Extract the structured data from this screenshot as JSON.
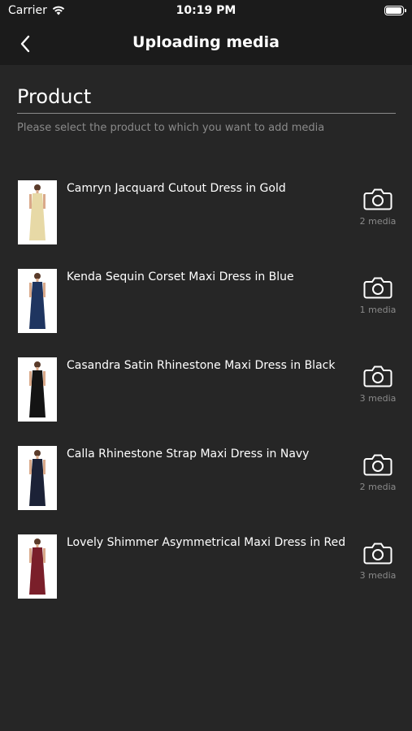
{
  "status_bar": {
    "carrier": "Carrier",
    "time": "10:19 PM",
    "battery_level": 1.0
  },
  "nav": {
    "title": "Uploading media",
    "back_icon": "chevron-left-icon"
  },
  "section": {
    "title": "Product",
    "hint": "Please select the product to which you want to add media"
  },
  "products": [
    {
      "name": "Camryn Jacquard Cutout Dress in Gold",
      "media": "2 media",
      "dress_color": "#e7d9a6",
      "icon": "camera-icon"
    },
    {
      "name": "Kenda Sequin Corset Maxi Dress in Blue",
      "media": "1 media",
      "dress_color": "#1f3560",
      "icon": "camera-icon"
    },
    {
      "name": "Casandra Satin Rhinestone Maxi Dress in Black",
      "media": "3 media",
      "dress_color": "#141414",
      "icon": "camera-icon"
    },
    {
      "name": "Calla Rhinestone Strap Maxi Dress in Navy",
      "media": "2 media",
      "dress_color": "#1c2237",
      "icon": "camera-icon"
    },
    {
      "name": "Lovely Shimmer Asymmetrical Maxi Dress in Red",
      "media": "3 media",
      "dress_color": "#7a1f2a",
      "icon": "camera-icon"
    }
  ],
  "colors": {
    "background": "#262626",
    "bar": "#1b1b1b",
    "muted_text": "#8a8a8a"
  }
}
